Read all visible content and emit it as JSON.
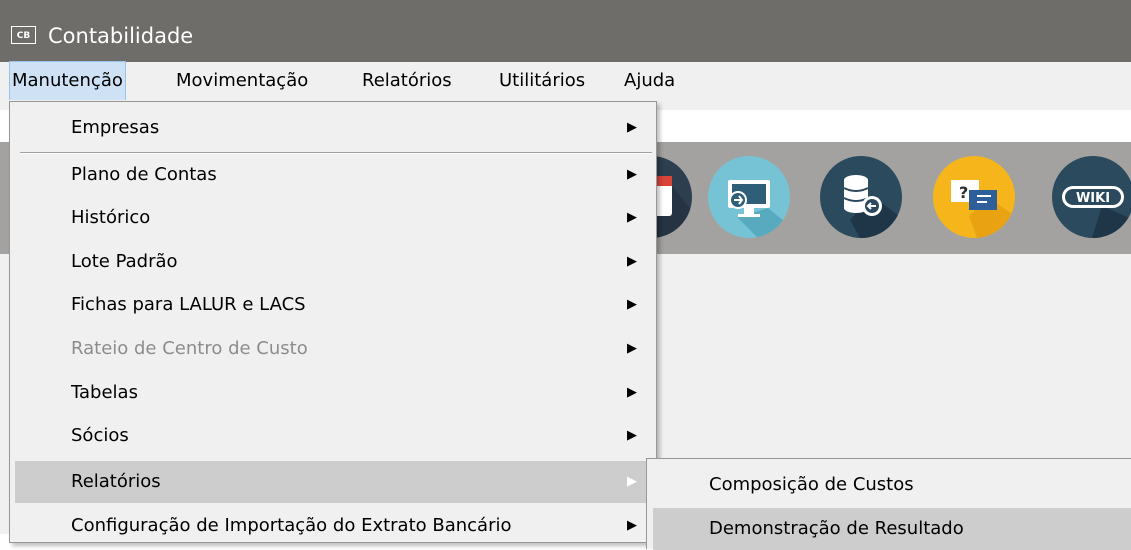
{
  "window": {
    "icon_text": "CB",
    "title": "Contabilidade"
  },
  "menubar": {
    "items": [
      "Manutenção",
      "Movimentação",
      "Relatórios",
      "Utilitários",
      "Ajuda"
    ]
  },
  "toolbar_icons": [
    "calendar-icon",
    "monitor-transfer-icon",
    "database-transfer-icon",
    "help-chat-icon",
    "wiki-icon"
  ],
  "wiki_label": "WIKI",
  "manutencao_menu": {
    "items": [
      {
        "label": "Empresas",
        "has_submenu": true
      },
      {
        "label": "Plano de Contas",
        "has_submenu": true
      },
      {
        "label": "Histórico",
        "has_submenu": true
      },
      {
        "label": "Lote Padrão",
        "has_submenu": true
      },
      {
        "label": "Fichas para LALUR e LACS",
        "has_submenu": true
      },
      {
        "label": "Rateio de Centro de Custo",
        "has_submenu": true,
        "disabled": true
      },
      {
        "label": "Tabelas",
        "has_submenu": true
      },
      {
        "label": "Sócios",
        "has_submenu": true
      },
      {
        "label": "Relatórios",
        "has_submenu": true,
        "highlighted": true
      },
      {
        "label": "Configuração de Importação do Extrato Bancário",
        "has_submenu": true
      }
    ],
    "arrow": "▶"
  },
  "relatorios_submenu": {
    "items": [
      "Composição de Custos",
      "Demonstração de Resultado"
    ]
  },
  "colors": {
    "titlebar": "#6e6d6a",
    "menu_bg": "#f0f0f0",
    "highlight": "#cdcdcd",
    "icon_band": "#a3a2a0"
  }
}
